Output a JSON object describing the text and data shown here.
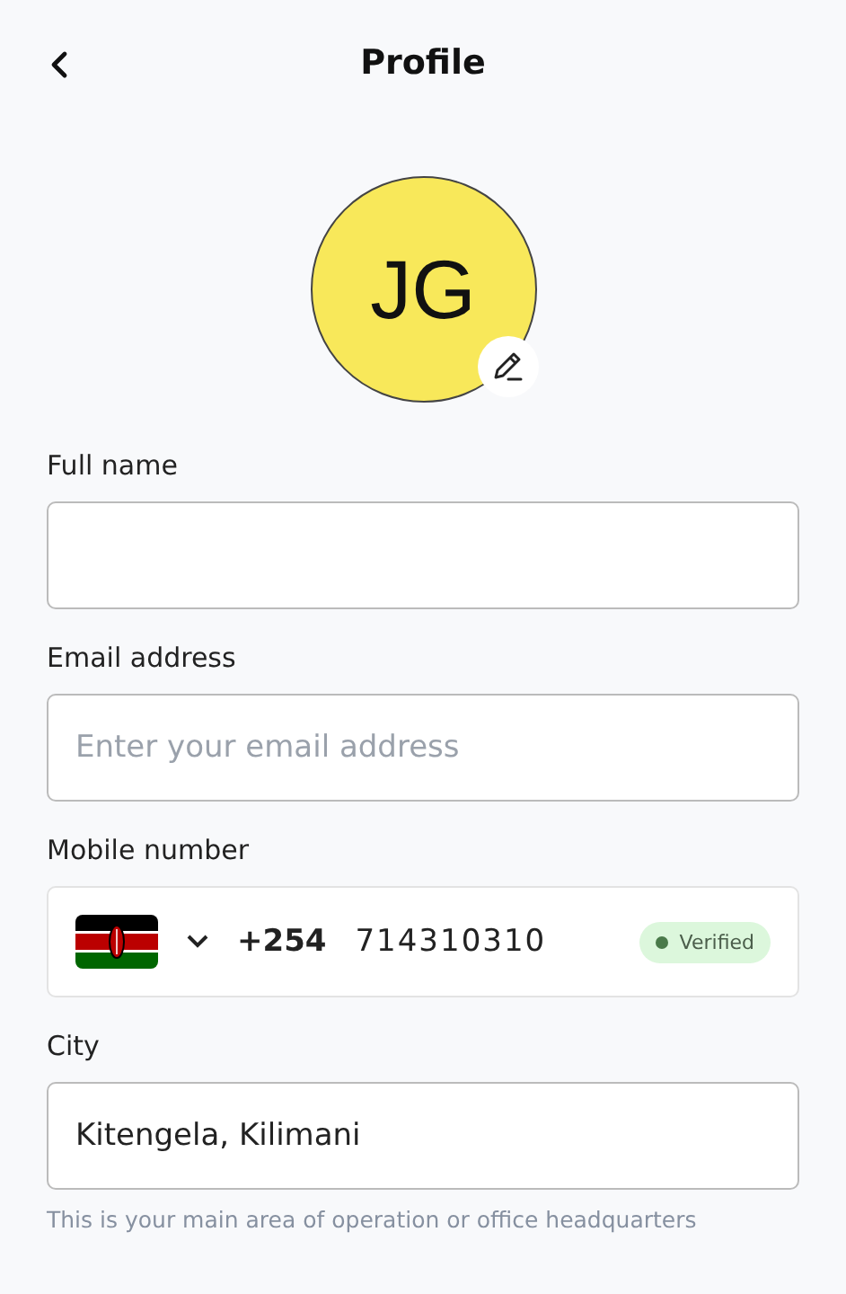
{
  "header": {
    "title": "Profile"
  },
  "avatar": {
    "initials": "JG"
  },
  "fields": [
    {
      "kind": "text",
      "label": "Full name"
    },
    {
      "kind": "text",
      "label": "Email address",
      "placeholder": "Enter your email address"
    },
    {
      "kind": "phone",
      "label": "Mobile number",
      "dial_code": "+254",
      "value": "714310310",
      "badge": "Verified"
    },
    {
      "kind": "text",
      "label": "City",
      "value": "Kitengela, Kilimani",
      "hint": "This is your main area of operation or office headquarters"
    }
  ]
}
